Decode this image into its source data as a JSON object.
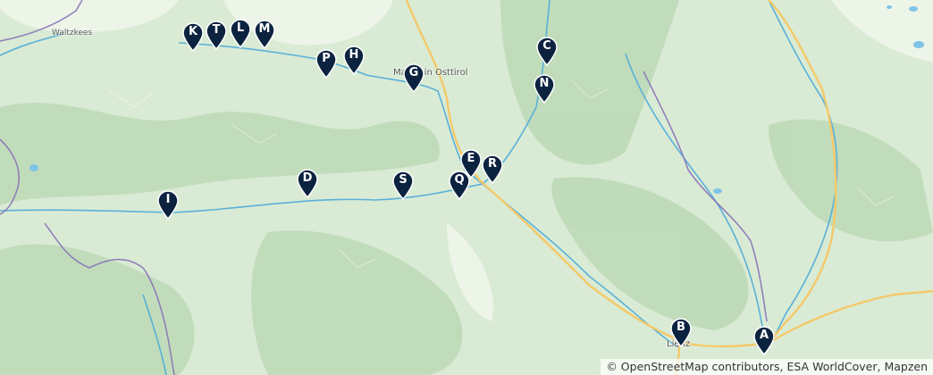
{
  "map": {
    "place_labels": {
      "waltzkees": "Waltzkees",
      "matrei": "Matrei in Osttirol",
      "lienz": "Lienz"
    },
    "attribution": "© OpenStreetMap contributors, ESA WorldCover, Mapzen",
    "colors": {
      "land": "#d9ebd4",
      "forest": "#b9d9b5",
      "river": "#5ab0d9",
      "road": "#f4c96a",
      "border": "#8a74b8",
      "marker": "#0c2340"
    },
    "markers": [
      {
        "id": "K",
        "label": "K"
      },
      {
        "id": "T",
        "label": "T"
      },
      {
        "id": "L",
        "label": "L"
      },
      {
        "id": "M",
        "label": "M"
      },
      {
        "id": "P",
        "label": "P"
      },
      {
        "id": "H",
        "label": "H"
      },
      {
        "id": "G",
        "label": "G"
      },
      {
        "id": "C",
        "label": "C"
      },
      {
        "id": "N",
        "label": "N"
      },
      {
        "id": "E",
        "label": "E"
      },
      {
        "id": "R",
        "label": "R"
      },
      {
        "id": "Q",
        "label": "Q"
      },
      {
        "id": "D",
        "label": "D"
      },
      {
        "id": "S",
        "label": "S"
      },
      {
        "id": "I",
        "label": "I"
      },
      {
        "id": "B",
        "label": "B"
      },
      {
        "id": "A",
        "label": "A"
      }
    ]
  }
}
